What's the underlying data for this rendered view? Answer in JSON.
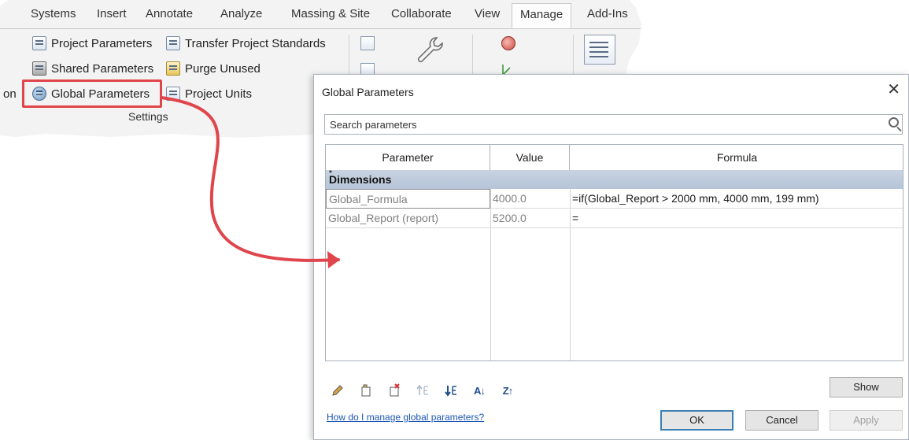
{
  "ribbon": {
    "tabs": [
      "Systems",
      "Insert",
      "Annotate",
      "Analyze",
      "Massing & Site",
      "Collaborate",
      "View",
      "Manage",
      "Add-Ins"
    ],
    "active_tab": "Manage",
    "items": {
      "project_parameters": "Project Parameters",
      "transfer_project_standards": "Transfer Project Standards",
      "shared_parameters": "Shared Parameters",
      "purge_unused": "Purge Unused",
      "global_parameters": "Global Parameters",
      "project_units": "Project Units",
      "cut_prefix": "on"
    },
    "panel_label": "Settings",
    "highlight_color": "#e0454b"
  },
  "dialog": {
    "title": "Global Parameters",
    "close_label": "✕",
    "search_placeholder": "Search parameters",
    "columns": [
      "Parameter",
      "Value",
      "Formula"
    ],
    "group": "Dimensions",
    "group_marker": "*",
    "rows": [
      {
        "parameter": "Global_Formula",
        "value": "4000.0",
        "formula": "=if(Global_Report > 2000 mm, 4000 mm, 199 mm)"
      },
      {
        "parameter": "Global_Report (report)",
        "value": "5200.0",
        "formula": "="
      }
    ],
    "toolbar_icons": [
      "edit-pencil-icon",
      "new-parameter-icon",
      "delete-parameter-icon",
      "move-up-icon",
      "move-down-icon",
      "sort-ascending-icon",
      "sort-descending-icon"
    ],
    "toolbar_glyphs": {
      "sort_ascending": "A↓",
      "sort_descending": "Z↑"
    },
    "show_button": "Show",
    "help_link": "How do I manage global parameters?",
    "ok_button": "OK",
    "cancel_button": "Cancel",
    "apply_button": "Apply"
  }
}
